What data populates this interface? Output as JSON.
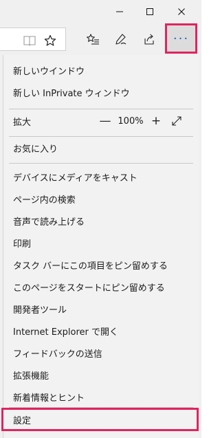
{
  "window_controls": {
    "minimize": "—",
    "maximize": "☐",
    "close": "✕"
  },
  "toolbar": {
    "reading_view_icon": "book-icon",
    "favorite_icon": "star-icon",
    "favorites_hub_icon": "favorites-list-icon",
    "notes_icon": "pen-icon",
    "share_icon": "share-icon",
    "more_label": "···",
    "accent_color": "#1b62c4",
    "highlight_color": "#e0245e"
  },
  "menu": {
    "new_window": "新しいウインドウ",
    "new_inprivate": "新しい InPrivate ウィンドウ",
    "zoom_label": "拡大",
    "zoom_minus": "—",
    "zoom_value": "100%",
    "zoom_plus": "+",
    "favorites": "お気に入り",
    "items": [
      "デバイスにメディアをキャスト",
      "ページ内の検索",
      "音声で読み上げる",
      "印刷",
      "タスク バーにこの項目をピン留めする",
      "このページをスタートにピン留めする",
      "開発者ツール",
      "Internet Explorer で開く",
      "フィードバックの送信",
      "拡張機能",
      "新着情報とヒント"
    ],
    "settings": "設定"
  }
}
